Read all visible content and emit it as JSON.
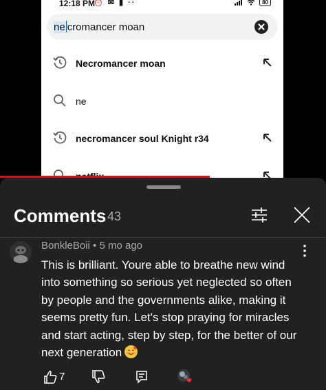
{
  "status_bar": {
    "time": "12:18 PM",
    "left_icons": "⏰ ✉ ▮ ··",
    "battery": "80"
  },
  "search": {
    "query_selected": "ne",
    "query_rest": "cromancer moan",
    "clear_icon": "close-circle-icon"
  },
  "suggestions": [
    {
      "icon": "history-icon",
      "text": "Necromancer moan",
      "bold": true,
      "arrow": true
    },
    {
      "icon": "search-icon",
      "text": "ne",
      "bold": false,
      "arrow": false
    },
    {
      "icon": "history-icon",
      "text": "necromancer soul Knight r34",
      "bold": true,
      "arrow": true
    },
    {
      "icon": "search-icon",
      "text": "netflix",
      "bold": true,
      "arrow": true
    }
  ],
  "comments_panel": {
    "title": "Comments",
    "count": "43",
    "filter_icon": "sliders-icon",
    "close_icon": "close-icon"
  },
  "comment": {
    "author_line": "BonkleBoii • 5 mo ago",
    "text": "This is brilliant. Youre able to breathe new wind into something so serious yet neglected so often by people and the governments alike, making it seems pretty fun. Let's stop praying for miracles and start acting, step by step, for the better of our next generation",
    "emoji": "smiling-face-with-hearts-emoji",
    "likes": "7"
  },
  "colors": {
    "sheet_bg": "#212121",
    "progress_red": "#ff0000",
    "selection_blue": "#d6e4fb"
  }
}
